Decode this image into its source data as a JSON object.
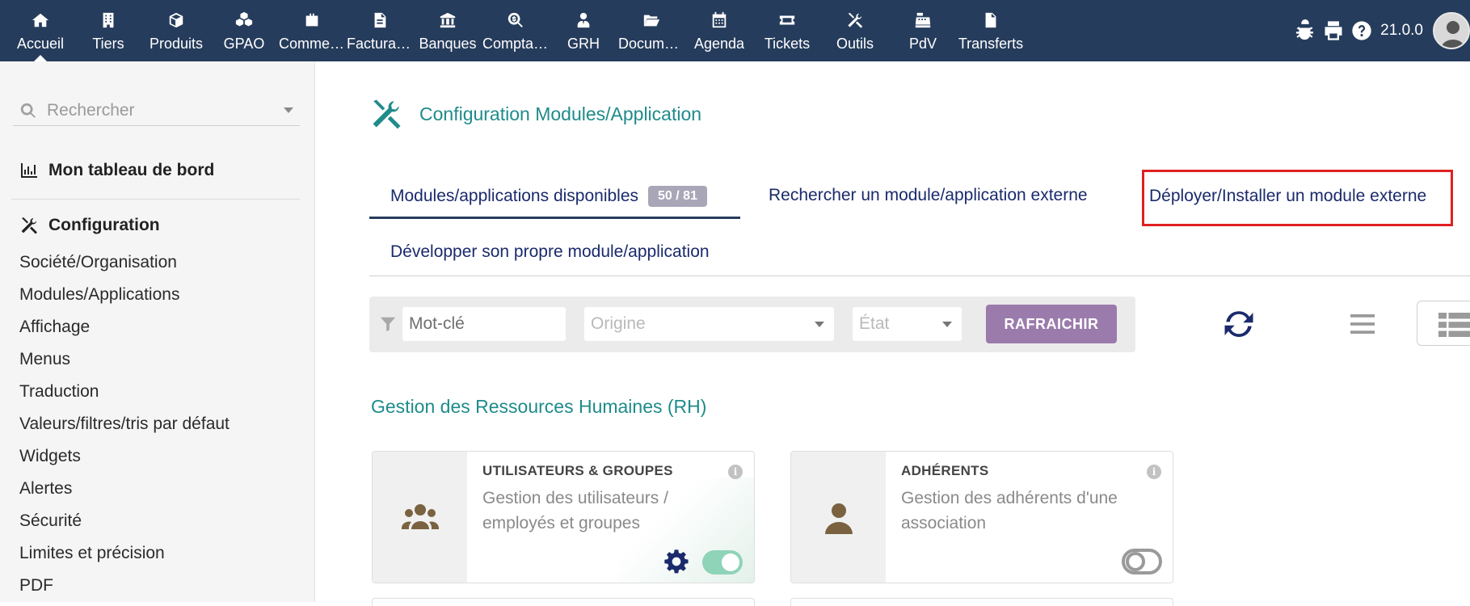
{
  "topbar": {
    "menu": [
      {
        "label": "Accueil",
        "icon": "home-icon",
        "active": true
      },
      {
        "label": "Tiers",
        "icon": "building-icon"
      },
      {
        "label": "Produits",
        "icon": "cube-icon"
      },
      {
        "label": "GPAO",
        "icon": "cubes-icon"
      },
      {
        "label": "Commercial",
        "icon": "suitcase-icon"
      },
      {
        "label": "Facturation",
        "icon": "invoice-icon"
      },
      {
        "label": "Banques",
        "icon": "bank-icon"
      },
      {
        "label": "Comptabilité",
        "icon": "search-dollar-icon"
      },
      {
        "label": "GRH",
        "icon": "user-tie-icon"
      },
      {
        "label": "Documents",
        "icon": "folder-open-icon"
      },
      {
        "label": "Agenda",
        "icon": "calendar-icon"
      },
      {
        "label": "Tickets",
        "icon": "ticket-icon"
      },
      {
        "label": "Outils",
        "icon": "tools-icon"
      },
      {
        "label": "PdV",
        "icon": "cash-register-icon"
      },
      {
        "label": "Transferts",
        "icon": "file-icon"
      }
    ],
    "version": "21.0.0",
    "icons": [
      "bug-icon",
      "print-icon",
      "help-icon"
    ]
  },
  "sidebar": {
    "search_placeholder": "Rechercher",
    "dashboard_label": "Mon tableau de bord",
    "config_label": "Configuration",
    "items": [
      "Société/Organisation",
      "Modules/Applications",
      "Affichage",
      "Menus",
      "Traduction",
      "Valeurs/filtres/tris par défaut",
      "Widgets",
      "Alertes",
      "Sécurité",
      "Limites et précision",
      "PDF"
    ]
  },
  "main": {
    "title": "Configuration Modules/Application",
    "tabs": {
      "available": "Modules/applications disponibles",
      "available_badge": "50 / 81",
      "search_external": "Rechercher un module/application externe",
      "deploy": "Déployer/Installer un module externe",
      "develop": "Développer son propre module/application"
    },
    "filters": {
      "keyword_value": "Mot-clé",
      "origin_placeholder": "Origine",
      "state_placeholder": "État",
      "refresh_label": "RAFRAICHIR"
    },
    "section_title": "Gestion des Ressources Humaines (RH)",
    "cards": [
      {
        "title": "UTILISATEURS & GROUPES",
        "desc": "Gestion des utilisateurs / employés et groupes",
        "icon": "users-icon",
        "enabled": true
      },
      {
        "title": "ADHÉRENTS",
        "desc": "Gestion des adhérents d'une association",
        "icon": "user-icon",
        "enabled": false
      }
    ]
  },
  "colors": {
    "topbar": "#263c5c",
    "accent_teal": "#1f8b8b",
    "link_navy": "#1a2a6c",
    "refresh_button": "#9b7bac",
    "highlight_red": "#e02020",
    "toggle_on": "#8fd3b9"
  }
}
